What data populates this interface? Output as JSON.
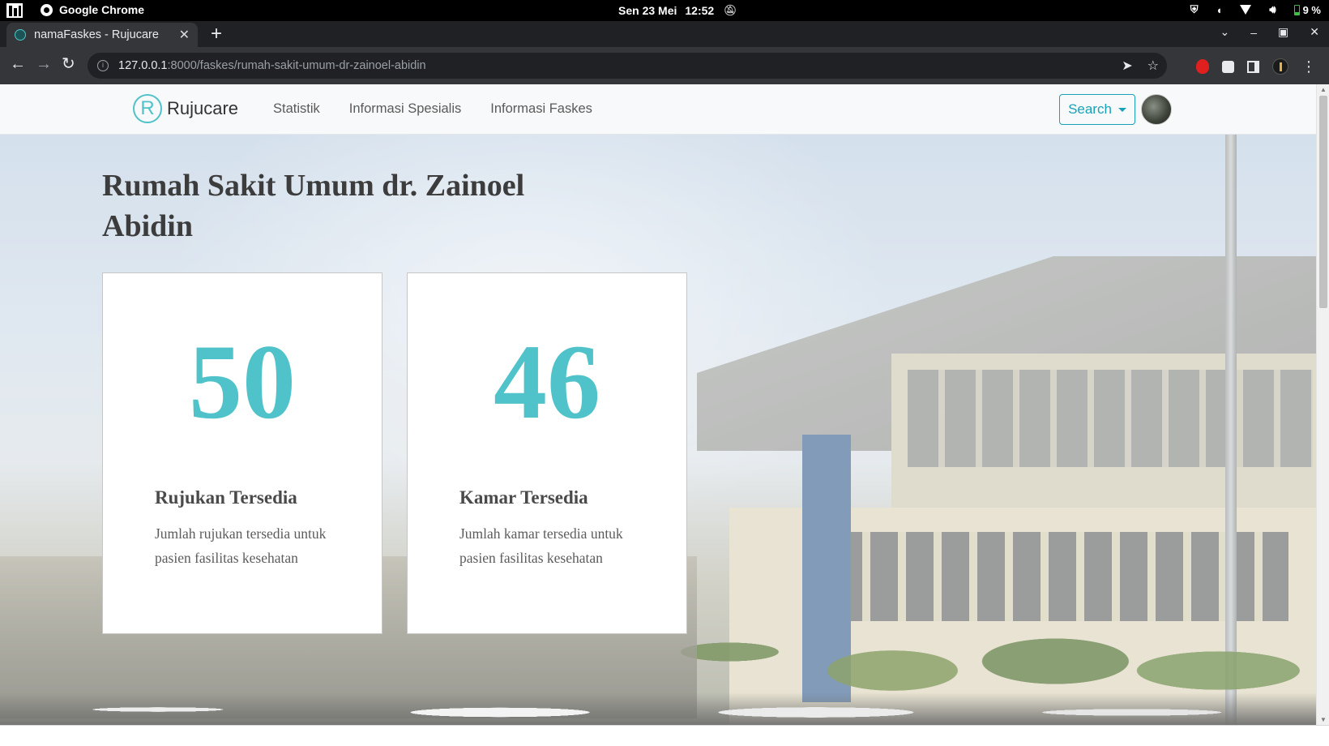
{
  "os": {
    "app_name": "Google Chrome",
    "date": "Sen 23 Mei",
    "time": "12:52",
    "battery": "9 %"
  },
  "browser": {
    "tab_title": "namaFaskes - Rujucare",
    "url_host": "127.0.0.1",
    "url_rest": ":8000/faskes/rumah-sakit-umum-dr-zainoel-abidin"
  },
  "navbar": {
    "brand_mark": "R",
    "brand": "Rujucare",
    "links": [
      "Statistik",
      "Informasi Spesialis",
      "Informasi Faskes"
    ],
    "search_label": "Search"
  },
  "page": {
    "title": "Rumah Sakit Umum dr. Zainoel Abidin",
    "cards": [
      {
        "value": "50",
        "title": "Rujukan Tersedia",
        "description": "Jumlah rujukan tersedia untuk pasien fasilitas kesehatan"
      },
      {
        "value": "46",
        "title": "Kamar Tersedia",
        "description": "Jumlah kamar tersedia untuk pasien fasilitas kesehatan"
      }
    ]
  },
  "colors": {
    "accent": "#4fc3c9",
    "search_border": "#17a2b8"
  }
}
